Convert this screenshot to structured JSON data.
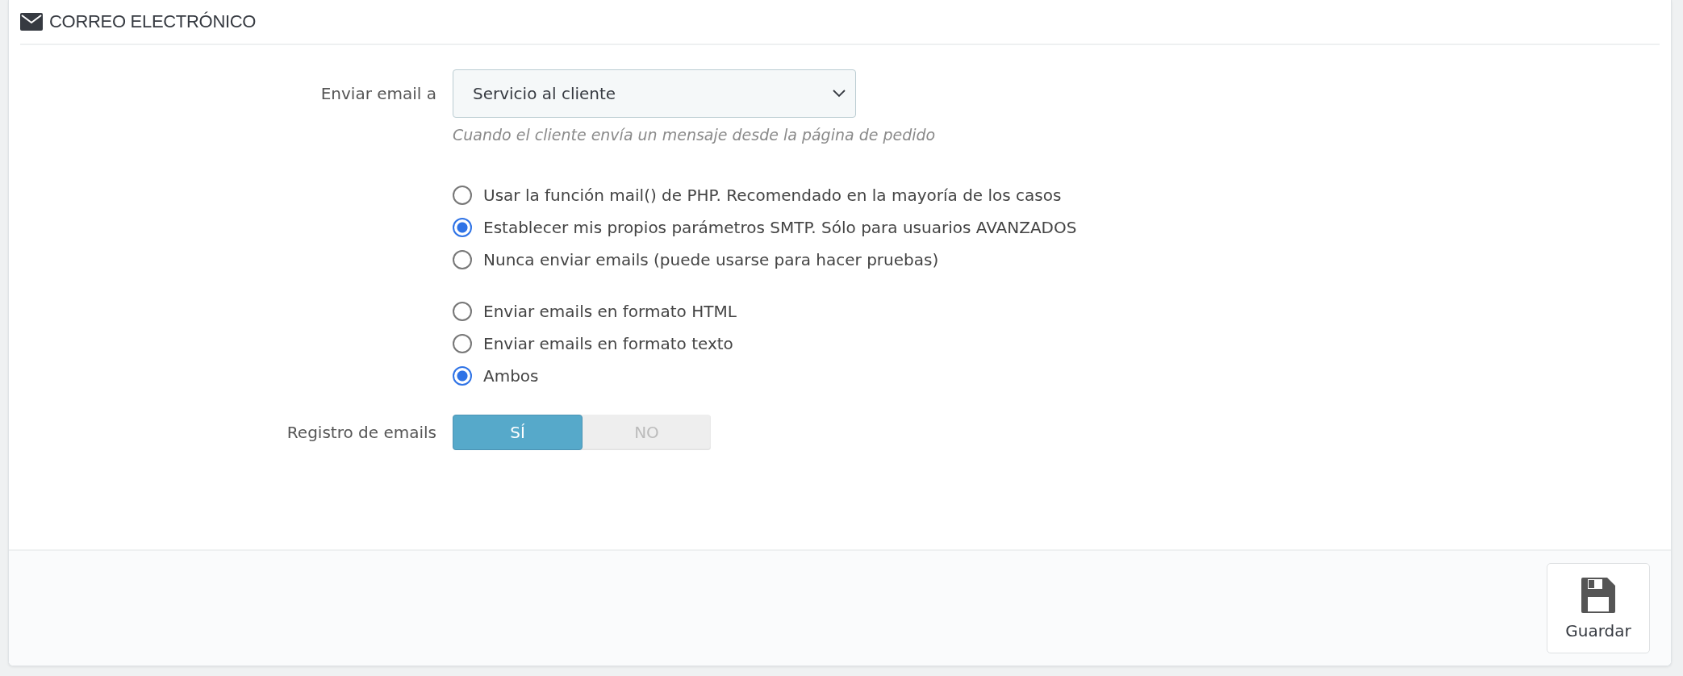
{
  "panel": {
    "title": "CORREO ELECTRÓNICO"
  },
  "send_to": {
    "label": "Enviar email a",
    "value": "Servicio al cliente",
    "help": "Cuando el cliente envía un mensaje desde la página de pedido"
  },
  "radio_groups": [
    {
      "options": [
        {
          "label": "Usar la función mail() de PHP. Recomendado en la mayoría de los casos",
          "selected": false
        },
        {
          "label": "Establecer mis propios parámetros SMTP. Sólo para usuarios AVANZADOS",
          "selected": true
        },
        {
          "label": "Nunca enviar emails (puede usarse para hacer pruebas)",
          "selected": false
        }
      ]
    },
    {
      "options": [
        {
          "label": "Enviar emails en formato HTML",
          "selected": false
        },
        {
          "label": "Enviar emails en formato texto",
          "selected": false
        },
        {
          "label": "Ambos",
          "selected": true
        }
      ]
    }
  ],
  "email_log": {
    "label": "Registro de emails",
    "options": [
      {
        "label": "SÍ",
        "selected": true
      },
      {
        "label": "NO",
        "selected": false
      }
    ]
  },
  "footer": {
    "save_label": "Guardar"
  }
}
